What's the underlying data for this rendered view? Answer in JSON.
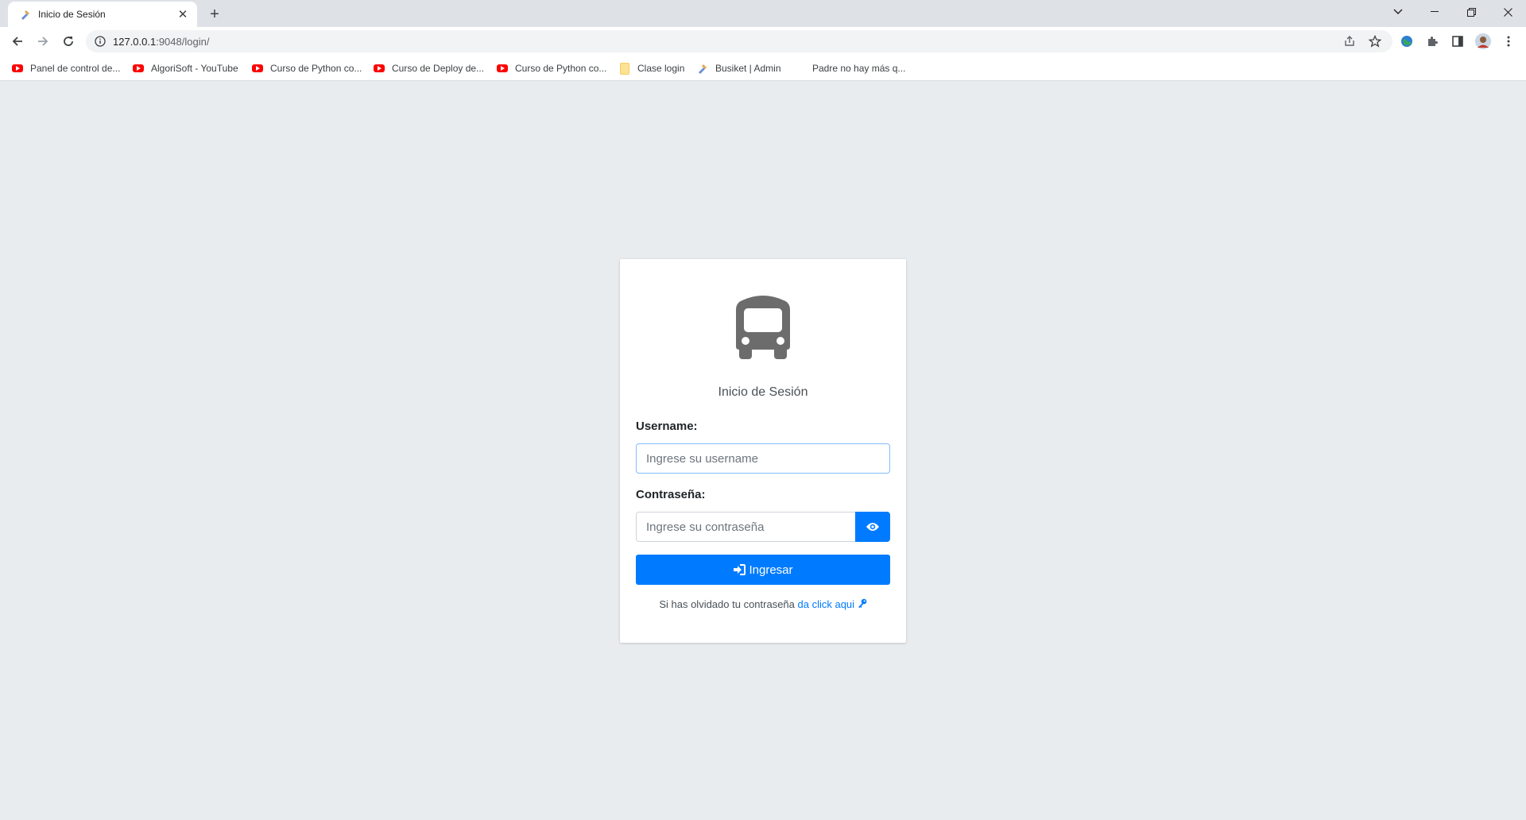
{
  "browser": {
    "tab_title": "Inicio de Sesión",
    "url_host": "127.0.0.1",
    "url_rest": ":9048/login/",
    "bookmarks": [
      {
        "label": "Panel de control de...",
        "icon": "youtube-icon"
      },
      {
        "label": "AlgoriSoft - YouTube",
        "icon": "youtube-icon"
      },
      {
        "label": "Curso de Python co...",
        "icon": "youtube-icon"
      },
      {
        "label": "Curso de Deploy de...",
        "icon": "youtube-icon"
      },
      {
        "label": "Curso de Python co...",
        "icon": "youtube-icon"
      },
      {
        "label": "Clase login",
        "icon": "folder-icon"
      },
      {
        "label": "Busiket | Admin",
        "icon": "busiket-icon"
      },
      {
        "label": "Padre no hay más q...",
        "icon": "none"
      }
    ]
  },
  "login": {
    "title": "Inicio de Sesión",
    "username_label": "Username:",
    "username_placeholder": "Ingrese su username",
    "password_label": "Contraseña:",
    "password_placeholder": "Ingrese su contraseña",
    "submit_label": "Ingresar",
    "forgot_text": "Si has olvidado tu contraseña ",
    "forgot_link": "da click aqui"
  },
  "colors": {
    "primary": "#007bff",
    "page_bg": "#e9ecef",
    "logo": "#6c6c6c"
  }
}
